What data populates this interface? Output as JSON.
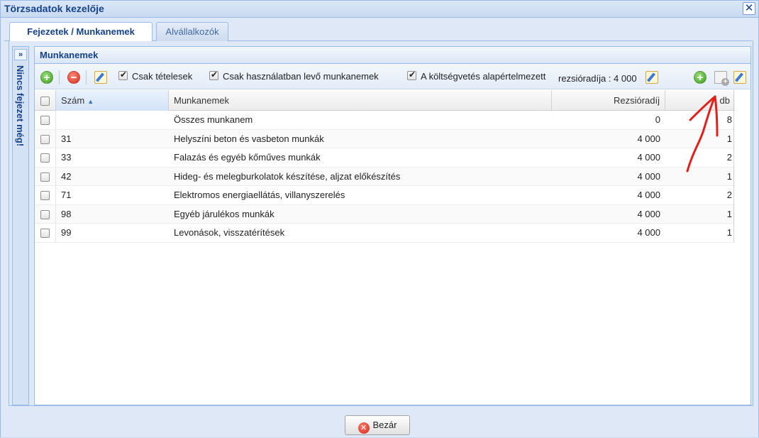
{
  "window": {
    "title": "Törzsadatok kezelője",
    "close_glyph": "✕"
  },
  "tabs": [
    {
      "label": "Fejezetek / Munkanemek",
      "active": true
    },
    {
      "label": "Alvállalkozók",
      "active": false
    }
  ],
  "side_panel": {
    "expand_glyph": "»",
    "label": "Nincs fejezet még!"
  },
  "panel": {
    "title": "Munkanemek"
  },
  "toolbar": {
    "add_glyph": "+",
    "remove_glyph": "−",
    "only_items_label": "Csak tételesek",
    "only_used_label": "Csak használatban levő munkanemek",
    "budget_default_label": "A költségvetés alapértelmezett",
    "overhead_rate_text": "rezsióradíja : 4 000",
    "right_add_glyph": "+"
  },
  "grid": {
    "columns": {
      "szam": "Szám",
      "munkanem": "Munkanemek",
      "rezsioradij": "Rezsióradíj",
      "db": "db"
    },
    "sort_glyph": "▲",
    "rows": [
      {
        "szam": "",
        "munkanem": "Összes munkanem",
        "rezsioradij": "0",
        "db": "8"
      },
      {
        "szam": "31",
        "munkanem": "Helyszíni beton és vasbeton munkák",
        "rezsioradij": "4 000",
        "db": "1"
      },
      {
        "szam": "33",
        "munkanem": "Falazás és egyéb kőműves munkák",
        "rezsioradij": "4 000",
        "db": "2"
      },
      {
        "szam": "42",
        "munkanem": "Hideg- és melegburkolatok készítése, aljzat előkészítés",
        "rezsioradij": "4 000",
        "db": "1"
      },
      {
        "szam": "71",
        "munkanem": "Elektromos energiaellátás, villanyszerelés",
        "rezsioradij": "4 000",
        "db": "2"
      },
      {
        "szam": "98",
        "munkanem": "Egyéb járulékos munkák",
        "rezsioradij": "4 000",
        "db": "1"
      },
      {
        "szam": "99",
        "munkanem": "Levonások, visszatérítések",
        "rezsioradij": "4 000",
        "db": "1"
      }
    ]
  },
  "footer": {
    "close_label": "Bezár",
    "close_glyph": "✕"
  },
  "colors": {
    "accent": "#15428b",
    "annotation": "#e0201b"
  }
}
